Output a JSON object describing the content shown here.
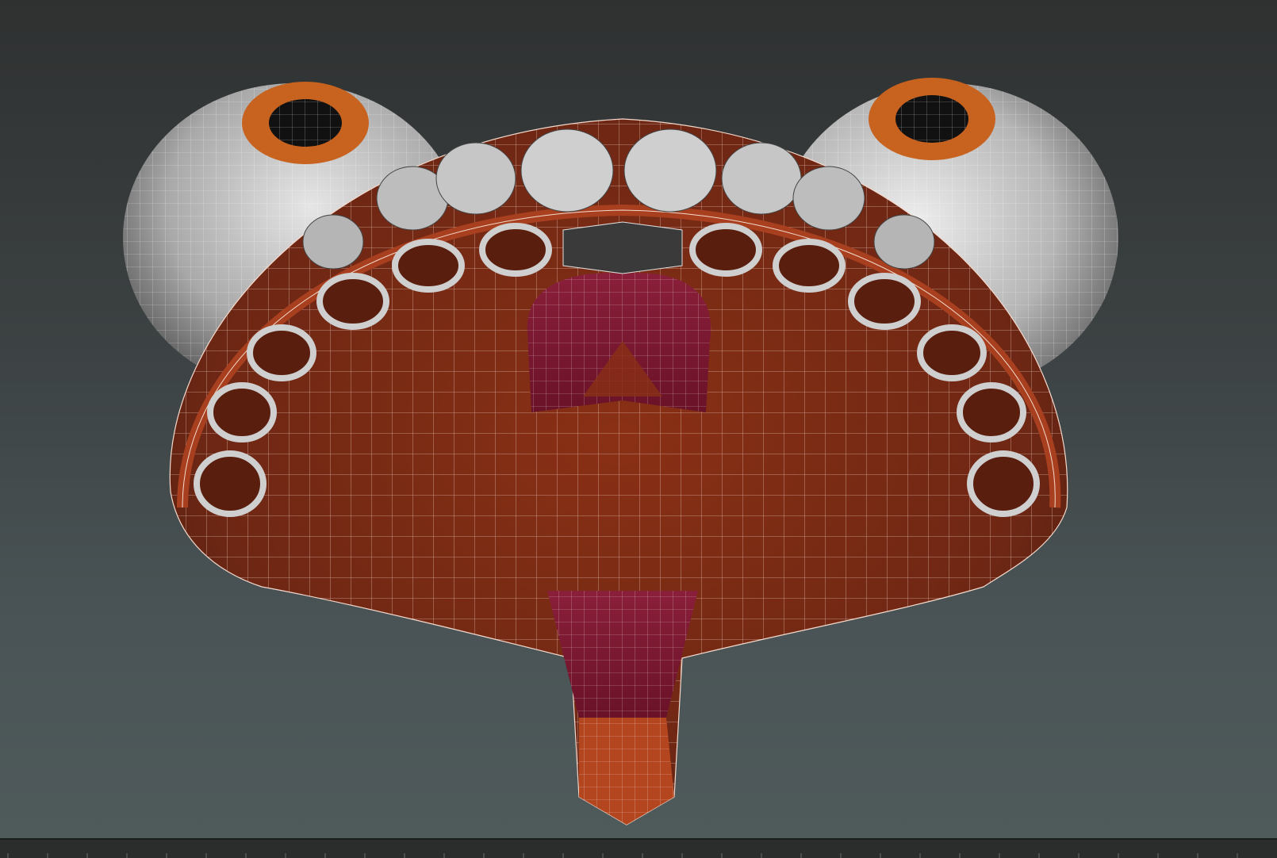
{
  "viewport": {
    "background_top": "#2f3131",
    "background_bottom": "#4f5a5b",
    "wire_color": "#f3d9cc",
    "skin_color": "#7a2a18",
    "skin_light": "#9a3820",
    "gum_color": "#6e1530",
    "tooth_color": "#c9c9c9",
    "iris_color": "#c8621f"
  },
  "statusbar": {
    "background": "#2b2d2d"
  }
}
